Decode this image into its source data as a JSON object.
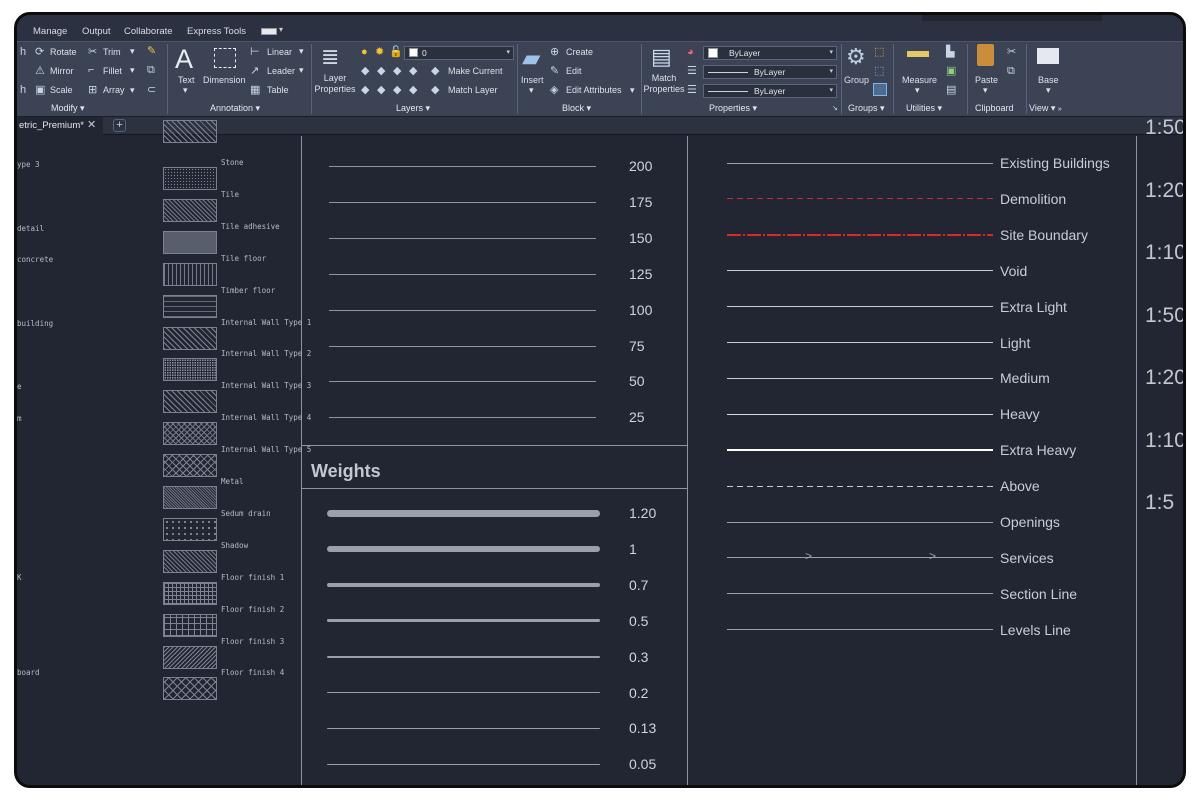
{
  "ribbon_tabs": [
    "Manage",
    "Output",
    "Collaborate",
    "Express Tools"
  ],
  "modify": {
    "label": "Modify",
    "items": [
      "Rotate",
      "Trim",
      "Mirror",
      "Fillet",
      "Scale",
      "Array"
    ]
  },
  "annotation": {
    "label": "Annotation",
    "big_text": "Text",
    "big_dimension": "Dimension",
    "items": [
      "Linear",
      "Leader",
      "Table"
    ]
  },
  "layers": {
    "label": "Layers",
    "big_layer_properties": "Layer\nProperties",
    "current_layer": "0",
    "items": [
      "Make Current",
      "Match Layer"
    ]
  },
  "block": {
    "label": "Block",
    "insert": "Insert",
    "items": [
      "Create",
      "Edit",
      "Edit Attributes"
    ]
  },
  "properties": {
    "label": "Properties",
    "match": "Match\nProperties",
    "color": "ByLayer",
    "linetype": "ByLayer",
    "lineweight": "ByLayer"
  },
  "groups": {
    "label": "Groups",
    "big": "Group"
  },
  "utilities": {
    "label": "Utilities",
    "big": "Measure"
  },
  "clipboard": {
    "label": "Clipboard",
    "big": "Paste"
  },
  "view": {
    "label": "View",
    "big": "Base"
  },
  "file_tab": {
    "name": "etric_Premium*",
    "close": "✕",
    "new": "+"
  },
  "left_fragments": [
    "ype 3",
    "detail",
    "concrete",
    "building",
    "e",
    "m",
    "K",
    "board"
  ],
  "hatches": [
    {
      "label": "Stone",
      "pattern": "fine-dots"
    },
    {
      "label": "Tile",
      "pattern": "diag-fine"
    },
    {
      "label": "Tile adhesive",
      "pattern": "stipple"
    },
    {
      "label": "Tile floor",
      "pattern": "vertical"
    },
    {
      "label": "Timber floor",
      "pattern": "wood"
    },
    {
      "label": "Internal Wall Type 1",
      "pattern": "diag"
    },
    {
      "label": "Internal Wall Type 2",
      "pattern": "dense-dots"
    },
    {
      "label": "Internal Wall Type 3",
      "pattern": "diag"
    },
    {
      "label": "Internal Wall Type 4",
      "pattern": "cross-fine"
    },
    {
      "label": "Internal Wall Type 5",
      "pattern": "cross"
    },
    {
      "label": "Metal",
      "pattern": "metal"
    },
    {
      "label": "Sedum drain",
      "pattern": "sparse-dots"
    },
    {
      "label": "Shadow",
      "pattern": "diag-fine"
    },
    {
      "label": "Floor finish 1",
      "pattern": "grid"
    },
    {
      "label": "Floor finish 2",
      "pattern": "grid-large"
    },
    {
      "label": "Floor finish 3",
      "pattern": "diag-dense"
    },
    {
      "label": "Floor finish 4",
      "pattern": "herringbone"
    }
  ],
  "thickness_values": [
    "200",
    "175",
    "150",
    "125",
    "100",
    "75",
    "50",
    "25"
  ],
  "weights_title": "Weights",
  "weights": [
    "1.20",
    "1",
    "0.7",
    "0.5",
    "0.3",
    "0.2",
    "0.13",
    "0.05"
  ],
  "linetypes": [
    {
      "label": "Existing Buildings",
      "style": "solid",
      "color": "#9aa0ad"
    },
    {
      "label": "Demolition",
      "style": "dashed",
      "color": "#c62d2d"
    },
    {
      "label": "Site Boundary",
      "style": "dashdot",
      "color": "#d42a2a"
    },
    {
      "label": "Void",
      "style": "solid",
      "color": "#c8ccd4"
    },
    {
      "label": "Extra Light",
      "style": "solid",
      "color": "#c8ccd4"
    },
    {
      "label": "Light",
      "style": "solid",
      "color": "#c8ccd4"
    },
    {
      "label": "Medium",
      "style": "solid",
      "color": "#c8ccd4"
    },
    {
      "label": "Heavy",
      "style": "solid",
      "color": "#d8dbe1"
    },
    {
      "label": "Extra Heavy",
      "style": "solid",
      "color": "#ffffff"
    },
    {
      "label": "Above",
      "style": "dashed",
      "color": "#c8ccd4"
    },
    {
      "label": "Openings",
      "style": "solid",
      "color": "#9aa0ad"
    },
    {
      "label": "Services",
      "style": "arrows",
      "color": "#9aa0ad"
    },
    {
      "label": "Section Line",
      "style": "solid",
      "color": "#9aa0ad"
    },
    {
      "label": "Levels Line",
      "style": "solid",
      "color": "#9aa0ad"
    }
  ],
  "scales": [
    "1:50",
    "1:20",
    "1:10",
    "1:50",
    "1:20",
    "1:10",
    "1:5"
  ]
}
